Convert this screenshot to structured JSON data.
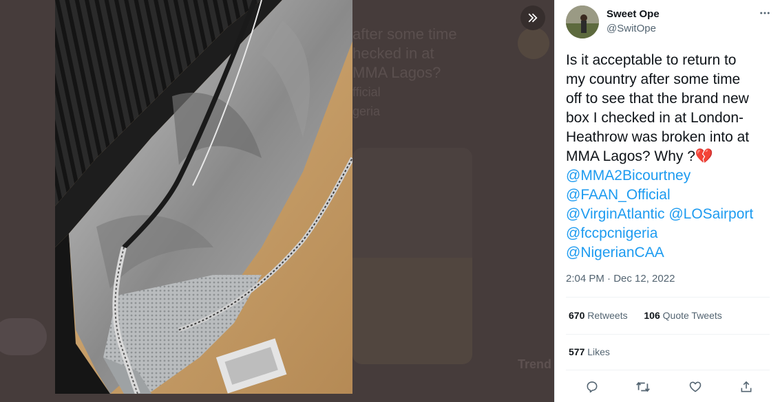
{
  "tweet": {
    "author_name": "Sweet Ope",
    "author_handle": "@SwitOpe",
    "text_lines": [
      "Is it acceptable to return to",
      "my country after some time",
      "off to see that the brand new",
      "box I checked in at London-",
      "Heathrow was broken into at",
      "MMA Lagos? Why ?"
    ],
    "emoji": "💔",
    "mentions": [
      "@MMA2Bicourtney",
      "@FAAN_Official",
      "@VirginAtlantic",
      "@LOSairport",
      "@fccpcnigeria",
      "@NigerianCAA"
    ],
    "timestamp": "2:04 PM · Dec 12, 2022",
    "retweets_count": "670",
    "retweets_label": "Retweets",
    "quote_count": "106",
    "quote_label": "Quote Tweets",
    "likes_count": "577",
    "likes_label": "Likes"
  },
  "background_ghost_text": {
    "lines": [
      "after some time",
      "hecked in at",
      "MMA Lagos?",
      "fficial",
      "geria"
    ],
    "trends_partial": "Trend"
  },
  "icons": {
    "expand": "double-chevron-right-icon",
    "more": "more-horizontal-icon",
    "reply": "reply-icon",
    "retweet": "retweet-icon",
    "like": "heart-icon",
    "share": "share-icon"
  },
  "colors": {
    "link": "#1d9bf0",
    "text": "#0f1419",
    "muted": "#536471",
    "backdrop": "#3e3535"
  }
}
